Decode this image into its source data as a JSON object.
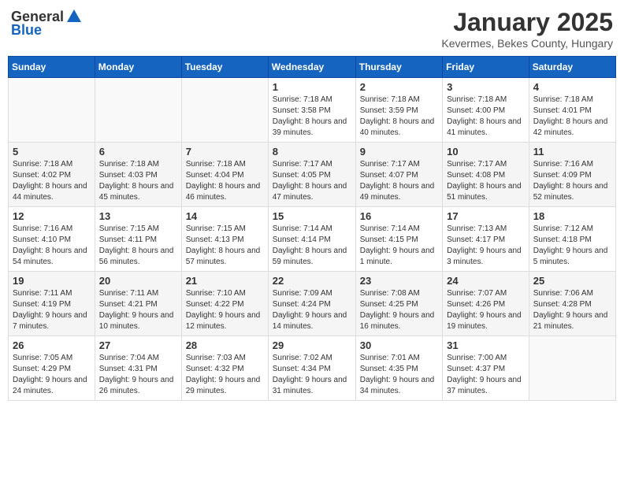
{
  "header": {
    "logo_general": "General",
    "logo_blue": "Blue",
    "month_year": "January 2025",
    "location": "Kevermes, Bekes County, Hungary"
  },
  "weekdays": [
    "Sunday",
    "Monday",
    "Tuesday",
    "Wednesday",
    "Thursday",
    "Friday",
    "Saturday"
  ],
  "weeks": [
    [
      {
        "day": "",
        "info": ""
      },
      {
        "day": "",
        "info": ""
      },
      {
        "day": "",
        "info": ""
      },
      {
        "day": "1",
        "info": "Sunrise: 7:18 AM\nSunset: 3:58 PM\nDaylight: 8 hours and 39 minutes."
      },
      {
        "day": "2",
        "info": "Sunrise: 7:18 AM\nSunset: 3:59 PM\nDaylight: 8 hours and 40 minutes."
      },
      {
        "day": "3",
        "info": "Sunrise: 7:18 AM\nSunset: 4:00 PM\nDaylight: 8 hours and 41 minutes."
      },
      {
        "day": "4",
        "info": "Sunrise: 7:18 AM\nSunset: 4:01 PM\nDaylight: 8 hours and 42 minutes."
      }
    ],
    [
      {
        "day": "5",
        "info": "Sunrise: 7:18 AM\nSunset: 4:02 PM\nDaylight: 8 hours and 44 minutes."
      },
      {
        "day": "6",
        "info": "Sunrise: 7:18 AM\nSunset: 4:03 PM\nDaylight: 8 hours and 45 minutes."
      },
      {
        "day": "7",
        "info": "Sunrise: 7:18 AM\nSunset: 4:04 PM\nDaylight: 8 hours and 46 minutes."
      },
      {
        "day": "8",
        "info": "Sunrise: 7:17 AM\nSunset: 4:05 PM\nDaylight: 8 hours and 47 minutes."
      },
      {
        "day": "9",
        "info": "Sunrise: 7:17 AM\nSunset: 4:07 PM\nDaylight: 8 hours and 49 minutes."
      },
      {
        "day": "10",
        "info": "Sunrise: 7:17 AM\nSunset: 4:08 PM\nDaylight: 8 hours and 51 minutes."
      },
      {
        "day": "11",
        "info": "Sunrise: 7:16 AM\nSunset: 4:09 PM\nDaylight: 8 hours and 52 minutes."
      }
    ],
    [
      {
        "day": "12",
        "info": "Sunrise: 7:16 AM\nSunset: 4:10 PM\nDaylight: 8 hours and 54 minutes."
      },
      {
        "day": "13",
        "info": "Sunrise: 7:15 AM\nSunset: 4:11 PM\nDaylight: 8 hours and 56 minutes."
      },
      {
        "day": "14",
        "info": "Sunrise: 7:15 AM\nSunset: 4:13 PM\nDaylight: 8 hours and 57 minutes."
      },
      {
        "day": "15",
        "info": "Sunrise: 7:14 AM\nSunset: 4:14 PM\nDaylight: 8 hours and 59 minutes."
      },
      {
        "day": "16",
        "info": "Sunrise: 7:14 AM\nSunset: 4:15 PM\nDaylight: 9 hours and 1 minute."
      },
      {
        "day": "17",
        "info": "Sunrise: 7:13 AM\nSunset: 4:17 PM\nDaylight: 9 hours and 3 minutes."
      },
      {
        "day": "18",
        "info": "Sunrise: 7:12 AM\nSunset: 4:18 PM\nDaylight: 9 hours and 5 minutes."
      }
    ],
    [
      {
        "day": "19",
        "info": "Sunrise: 7:11 AM\nSunset: 4:19 PM\nDaylight: 9 hours and 7 minutes."
      },
      {
        "day": "20",
        "info": "Sunrise: 7:11 AM\nSunset: 4:21 PM\nDaylight: 9 hours and 10 minutes."
      },
      {
        "day": "21",
        "info": "Sunrise: 7:10 AM\nSunset: 4:22 PM\nDaylight: 9 hours and 12 minutes."
      },
      {
        "day": "22",
        "info": "Sunrise: 7:09 AM\nSunset: 4:24 PM\nDaylight: 9 hours and 14 minutes."
      },
      {
        "day": "23",
        "info": "Sunrise: 7:08 AM\nSunset: 4:25 PM\nDaylight: 9 hours and 16 minutes."
      },
      {
        "day": "24",
        "info": "Sunrise: 7:07 AM\nSunset: 4:26 PM\nDaylight: 9 hours and 19 minutes."
      },
      {
        "day": "25",
        "info": "Sunrise: 7:06 AM\nSunset: 4:28 PM\nDaylight: 9 hours and 21 minutes."
      }
    ],
    [
      {
        "day": "26",
        "info": "Sunrise: 7:05 AM\nSunset: 4:29 PM\nDaylight: 9 hours and 24 minutes."
      },
      {
        "day": "27",
        "info": "Sunrise: 7:04 AM\nSunset: 4:31 PM\nDaylight: 9 hours and 26 minutes."
      },
      {
        "day": "28",
        "info": "Sunrise: 7:03 AM\nSunset: 4:32 PM\nDaylight: 9 hours and 29 minutes."
      },
      {
        "day": "29",
        "info": "Sunrise: 7:02 AM\nSunset: 4:34 PM\nDaylight: 9 hours and 31 minutes."
      },
      {
        "day": "30",
        "info": "Sunrise: 7:01 AM\nSunset: 4:35 PM\nDaylight: 9 hours and 34 minutes."
      },
      {
        "day": "31",
        "info": "Sunrise: 7:00 AM\nSunset: 4:37 PM\nDaylight: 9 hours and 37 minutes."
      },
      {
        "day": "",
        "info": ""
      }
    ]
  ]
}
